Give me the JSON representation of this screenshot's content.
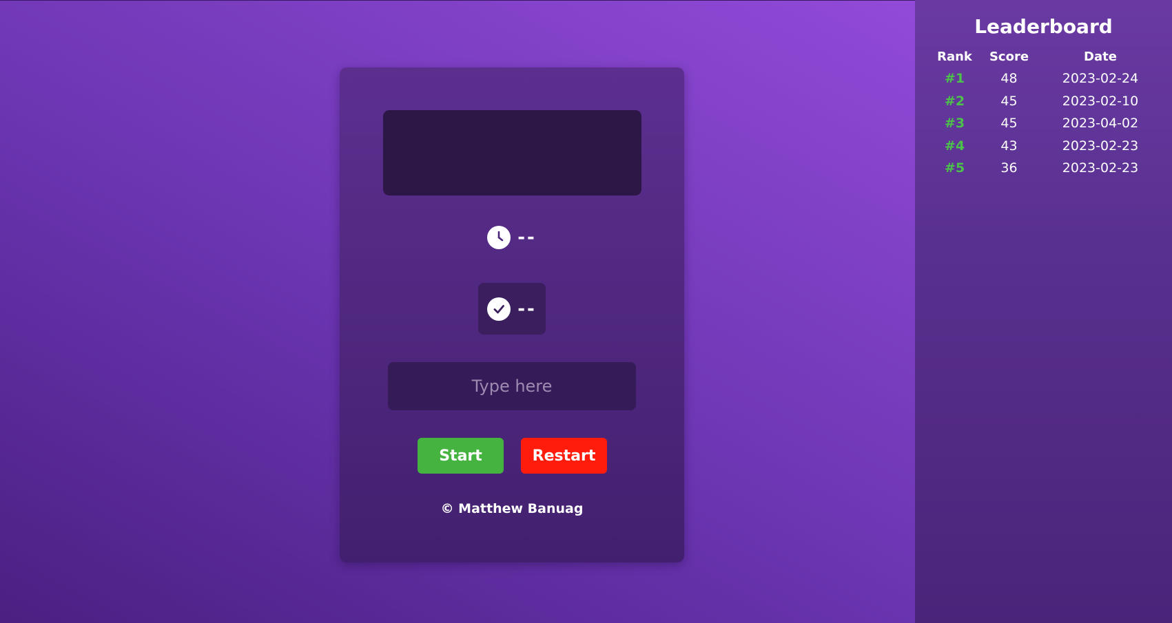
{
  "game": {
    "timer_value": "--",
    "words_value": "--",
    "input_placeholder": "Type here",
    "start_label": "Start",
    "restart_label": "Restart",
    "copyright": "© Matthew Banuag",
    "icons": {
      "timer": "clock-icon",
      "words": "check-circle-icon"
    }
  },
  "leaderboard": {
    "title": "Leaderboard",
    "columns": [
      "Rank",
      "Score",
      "Date"
    ],
    "rows": [
      {
        "rank": "#1",
        "score": "48",
        "date": "2023-02-24"
      },
      {
        "rank": "#2",
        "score": "45",
        "date": "2023-02-10"
      },
      {
        "rank": "#3",
        "score": "45",
        "date": "2023-04-02"
      },
      {
        "rank": "#4",
        "score": "43",
        "date": "2023-02-23"
      },
      {
        "rank": "#5",
        "score": "36",
        "date": "2023-02-23"
      }
    ]
  },
  "colors": {
    "start": "#45b33f",
    "restart": "#ff1c0d",
    "rank": "#4cc24a"
  }
}
